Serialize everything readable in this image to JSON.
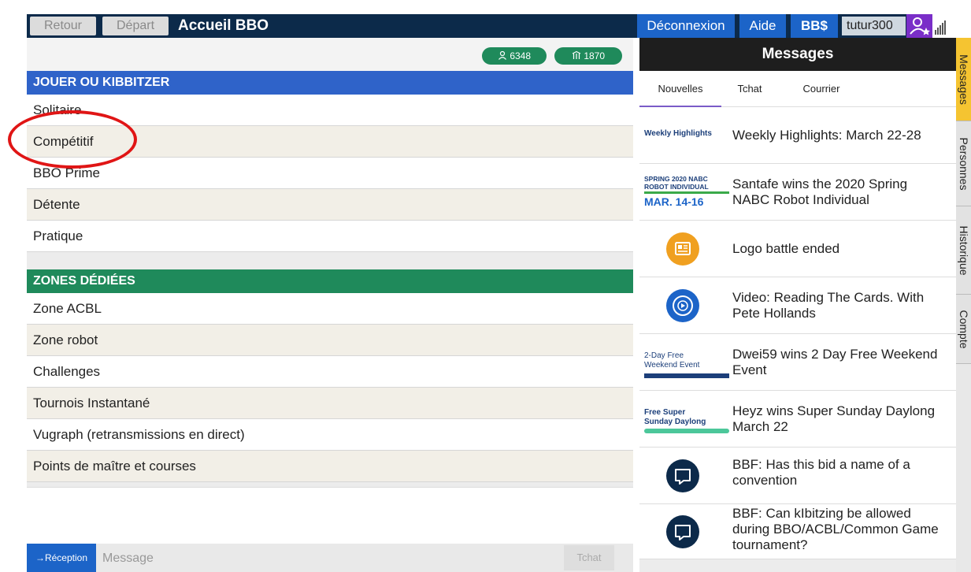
{
  "topbar": {
    "back_label": "Retour",
    "home_label": "Départ",
    "title": "Accueil BBO",
    "logout_label": "Déconnexion",
    "help_label": "Aide",
    "bbd_label": "BB$",
    "username": "tutur300"
  },
  "counters": {
    "users": "6348",
    "tables": "1870"
  },
  "play_section": {
    "title": "JOUER OU KIBBITZER",
    "items": [
      "Solitaire",
      "Compétitif",
      "BBO Prime",
      "Détente",
      "Pratique"
    ]
  },
  "zones_section": {
    "title": "ZONES DÉDIÉES",
    "items": [
      "Zone ACBL",
      "Zone robot",
      "Challenges",
      "Tournois Instantané",
      "Vugraph (retransmissions en direct)",
      "Points de maître et courses"
    ]
  },
  "chat": {
    "reception_label": "→Réception",
    "message_placeholder": "Message",
    "send_label": "Tchat"
  },
  "messages": {
    "title": "Messages",
    "tabs": [
      "Nouvelles",
      "Tchat",
      "Courrier"
    ],
    "news": [
      {
        "thumb_text": "Weekly Highlights",
        "text": "Weekly Highlights: March 22-28"
      },
      {
        "thumb_line1": "SPRING 2020 NABC",
        "thumb_line2": "ROBOT INDIVIDUAL",
        "thumb_date": "MAR. 14-16",
        "text": "Santafe wins the 2020 Spring NABC Robot Individual"
      },
      {
        "icon": "id-card-icon",
        "text": "Logo battle ended"
      },
      {
        "icon": "video-reel-icon",
        "text": "Video: Reading The Cards. With Pete Hollands"
      },
      {
        "thumb_line1": "2-Day Free",
        "thumb_line2": "Weekend Event",
        "text": "Dwei59 wins 2 Day Free Weekend Event"
      },
      {
        "thumb_line1": "Free Super",
        "thumb_line2": "Sunday Daylong",
        "text": "Heyz wins Super Sunday Daylong March 22"
      },
      {
        "icon": "chat-bubble-icon",
        "text": "BBF: Has this bid a name of a convention"
      },
      {
        "icon": "chat-bubble-icon",
        "text": "BBF: Can kIbitzing be allowed during BBO/ACBL/Common Game tournament?"
      }
    ]
  },
  "side_tabs": [
    "Messages",
    "Personnes",
    "Historique",
    "Compte"
  ],
  "colors": {
    "topbar": "#0c2a4a",
    "accent_blue": "#1c64c8",
    "play_header": "#2f63c9",
    "zones_header": "#1f8a5b",
    "active_side_tab": "#f5c431",
    "annotation": "#e01515"
  }
}
